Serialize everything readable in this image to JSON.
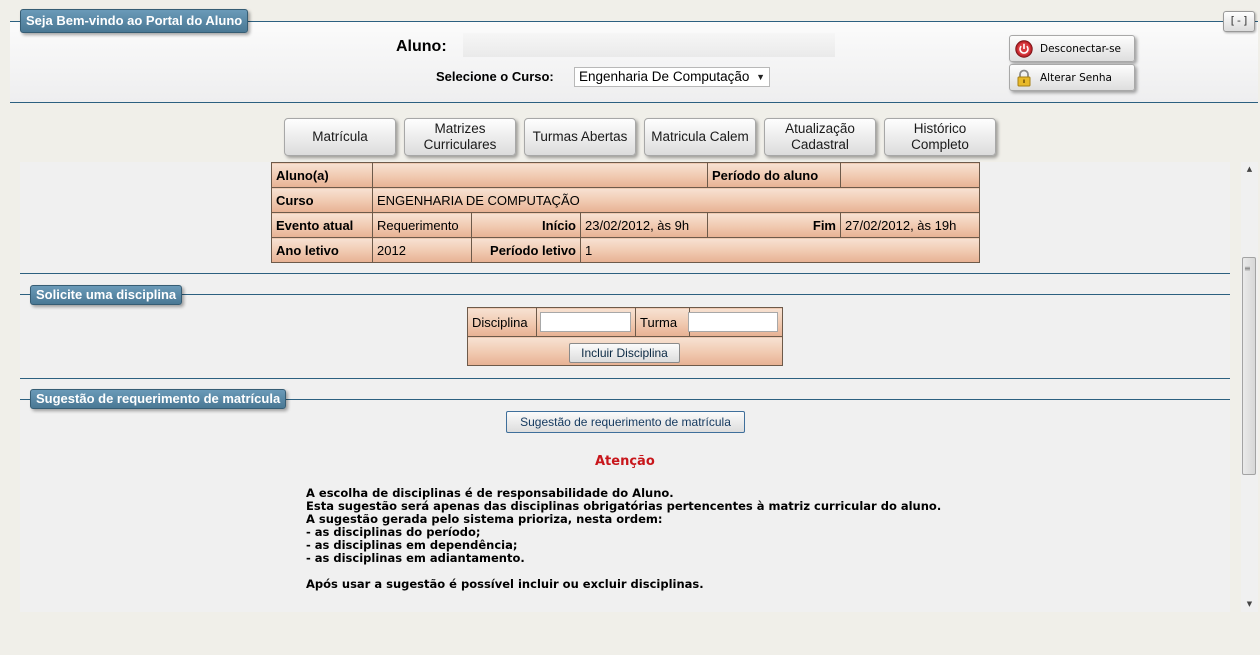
{
  "header": {
    "welcome_title": "Seja Bem-vindo ao Portal do Aluno",
    "collapse_label": "[-]",
    "aluno_label": "Aluno:",
    "curso_label": "Selecione o Curso:",
    "curso_selected": "Engenharia De Computação",
    "logout_label": "Desconectar-se",
    "change_password_label": "Alterar Senha"
  },
  "nav": [
    {
      "label": "Matrícula"
    },
    {
      "label": "Matrizes\nCurriculares"
    },
    {
      "label": "Turmas Abertas"
    },
    {
      "label": "Matricula Calem"
    },
    {
      "label": "Atualização\nCadastral"
    },
    {
      "label": "Histórico\nCompleto"
    }
  ],
  "student_info": {
    "aluno_label": "Aluno(a)",
    "aluno_value": "",
    "periodo_aluno_label": "Período do aluno",
    "periodo_aluno_value": "",
    "curso_label": "Curso",
    "curso_value": "ENGENHARIA DE COMPUTAÇÃO",
    "evento_label": "Evento atual",
    "evento_value": "Requerimento",
    "inicio_label": "Início",
    "inicio_value": "23/02/2012, às 9h",
    "fim_label": "Fim",
    "fim_value": "27/02/2012, às 19h",
    "ano_label": "Ano letivo",
    "ano_value": "2012",
    "periodo_letivo_label": "Período letivo",
    "periodo_letivo_value": "1"
  },
  "solicite": {
    "title": "Solicite uma disciplina",
    "disciplina_label": "Disciplina",
    "disciplina_value": "",
    "turma_label": "Turma",
    "turma_value": "",
    "incluir_label": "Incluir Disciplina"
  },
  "sugestao": {
    "title": "Sugestão de requerimento de matrícula",
    "button_label": "Sugestão de requerimento de matrícula",
    "atencao": "Atenção",
    "notice_lines": [
      "A escolha de disciplinas é de responsabilidade do Aluno.",
      "Esta sugestão será apenas das disciplinas obrigatórias pertencentes à matriz curricular do aluno.",
      "A sugestão gerada pelo sistema prioriza, nesta ordem:",
      "- as disciplinas do período;",
      "- as disciplinas em dependência;",
      "- as disciplinas em adiantamento.",
      "",
      "Após usar a sugestão é possível incluir ou excluir disciplinas."
    ]
  },
  "colors": {
    "accent": "#4a7894",
    "table_fill": "#f0c9b0",
    "warning": "#c8161b"
  }
}
